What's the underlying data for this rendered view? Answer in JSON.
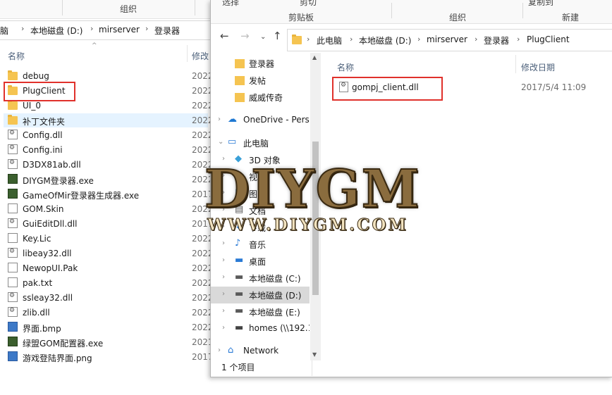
{
  "back_window": {
    "ribbon": {
      "group_left": "组织"
    },
    "breadcrumb": [
      "脑",
      "本地磁盘 (D:)",
      "mirserver",
      "登录器"
    ],
    "columns": {
      "name": "名称",
      "modified": "修改日"
    },
    "files": [
      {
        "name": "debug",
        "date": "2022",
        "type": "folder"
      },
      {
        "name": "PlugClient",
        "date": "2022",
        "type": "folder"
      },
      {
        "name": "UI_0",
        "date": "2022",
        "type": "folder"
      },
      {
        "name": "补丁文件夹",
        "date": "2022",
        "type": "folder"
      },
      {
        "name": "Config.dll",
        "date": "2022",
        "type": "dll"
      },
      {
        "name": "Config.ini",
        "date": "2022",
        "type": "ini"
      },
      {
        "name": "D3DX81ab.dll",
        "date": "2022",
        "type": "dll"
      },
      {
        "name": "DIYGM登录器.exe",
        "date": "2022",
        "type": "exe"
      },
      {
        "name": "GameOfMir登录器生成器.exe",
        "date": "2017",
        "type": "exe"
      },
      {
        "name": "GOM.Skin",
        "date": "2022",
        "type": "file"
      },
      {
        "name": "GuiEditDll.dll",
        "date": "2017",
        "type": "dll"
      },
      {
        "name": "Key.Lic",
        "date": "2022",
        "type": "file"
      },
      {
        "name": "libeay32.dll",
        "date": "2022",
        "type": "dll"
      },
      {
        "name": "NewopUI.Pak",
        "date": "2022",
        "type": "file"
      },
      {
        "name": "pak.txt",
        "date": "2022",
        "type": "file"
      },
      {
        "name": "ssleay32.dll",
        "date": "2022",
        "type": "dll"
      },
      {
        "name": "zlib.dll",
        "date": "2022",
        "type": "dll"
      },
      {
        "name": "界面.bmp",
        "date": "2022",
        "type": "image"
      },
      {
        "name": "绿盟GOM配置器.exe",
        "date": "2021",
        "type": "exe"
      },
      {
        "name": "游戏登陆界面.png",
        "date": "2017",
        "type": "image"
      }
    ]
  },
  "front_window": {
    "ribbon": {
      "top_left": "选择",
      "cut": "剪切",
      "top_right": "复制到",
      "clipboard": "剪贴板",
      "organize": "组织",
      "new": "新建"
    },
    "breadcrumb": [
      "此电脑",
      "本地磁盘 (D:)",
      "mirserver",
      "登录器",
      "PlugClient"
    ],
    "columns": {
      "name": "名称",
      "modified": "修改日期"
    },
    "files": [
      {
        "name": "gompj_client.dll",
        "date": "2017/5/4 11:09"
      }
    ],
    "tree": [
      {
        "label": "登录器",
        "icon": "folder",
        "indent": 1
      },
      {
        "label": "发帖",
        "icon": "folder",
        "indent": 1
      },
      {
        "label": "威威传奇",
        "icon": "folder",
        "indent": 1
      },
      {
        "label": "OneDrive - Perso",
        "icon": "cloud",
        "indent": 0,
        "chevron": "›"
      },
      {
        "label": "此电脑",
        "icon": "pc",
        "indent": 0,
        "chevron": "⌄"
      },
      {
        "label": "3D 对象",
        "icon": "cube",
        "indent": 1,
        "chevron": "›"
      },
      {
        "label": "视",
        "icon": "video",
        "indent": 1,
        "chevron": "›"
      },
      {
        "label": "图",
        "icon": "picture",
        "indent": 1,
        "chevron": "›"
      },
      {
        "label": "文档",
        "icon": "doc",
        "indent": 1,
        "chevron": "›"
      },
      {
        "label": "下载",
        "icon": "download",
        "indent": 1,
        "chevron": "›"
      },
      {
        "label": "音乐",
        "icon": "music",
        "indent": 1,
        "chevron": "›"
      },
      {
        "label": "桌面",
        "icon": "desktop",
        "indent": 1,
        "chevron": "›"
      },
      {
        "label": "本地磁盘 (C:)",
        "icon": "drive-win",
        "indent": 1,
        "chevron": "›"
      },
      {
        "label": "本地磁盘 (D:)",
        "icon": "drive",
        "indent": 1,
        "chevron": "›",
        "selected": true
      },
      {
        "label": "本地磁盘 (E:)",
        "icon": "drive",
        "indent": 1,
        "chevron": "›"
      },
      {
        "label": "homes (\\\\192.1",
        "icon": "network-drive",
        "indent": 1,
        "chevron": "›"
      },
      {
        "label": "Network",
        "icon": "network",
        "indent": 0,
        "chevron": "›"
      }
    ],
    "status": "1 个项目"
  },
  "watermark": {
    "big": "DIYGM",
    "small": "WWW.DIYGM.COM"
  },
  "colors": {
    "highlight": "#e0312b",
    "folder": "#f5c451",
    "selected": "#e5f3ff"
  }
}
